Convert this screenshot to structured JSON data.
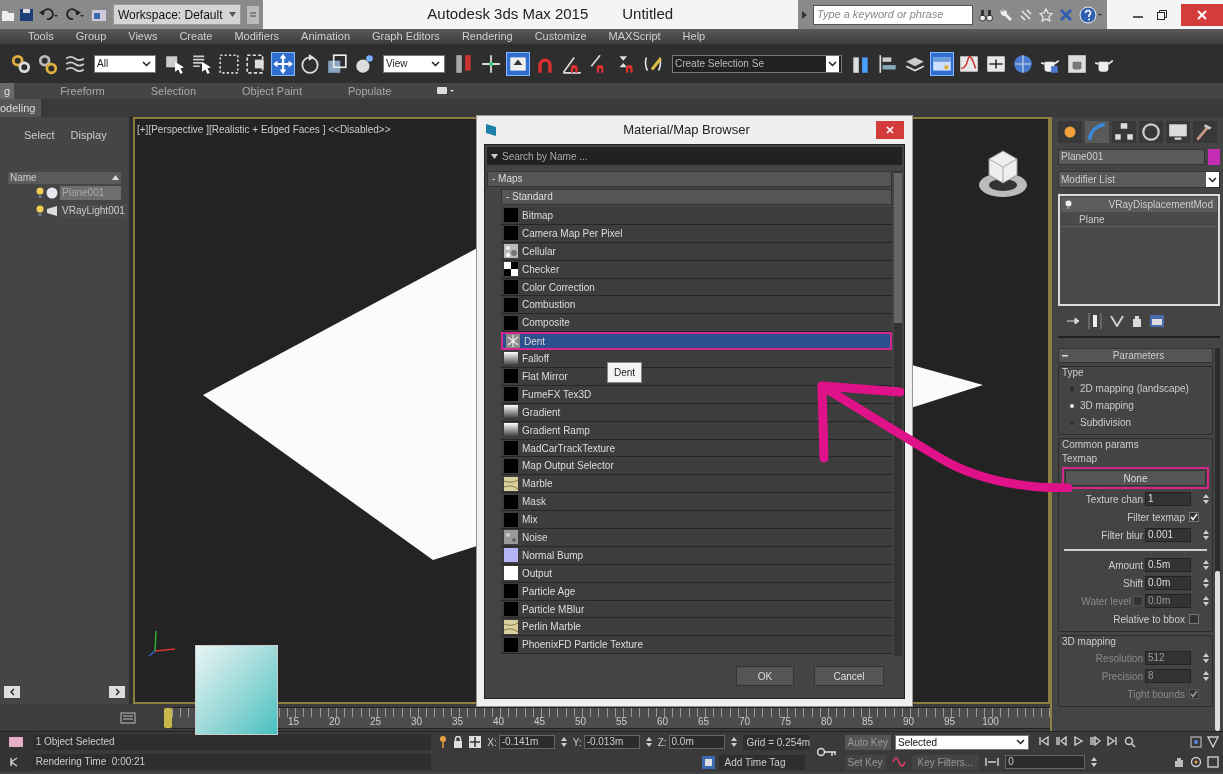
{
  "title_bar": {
    "workspace": "Workspace: Default",
    "app_title": "Autodesk 3ds Max 2015",
    "document": "Untitled",
    "search_placeholder": "Type a keyword or phrase"
  },
  "menu_bar": [
    "Tools",
    "Group",
    "Views",
    "Create",
    "Modifiers",
    "Animation",
    "Graph Editors",
    "Rendering",
    "Customize",
    "MAXScript",
    "Help"
  ],
  "toolbar": [
    {
      "kind": "icon",
      "active": false
    },
    {
      "kind": "icon",
      "active": false
    },
    {
      "kind": "icon",
      "active": false
    },
    {
      "kind": "dropdown",
      "value": "All"
    },
    {
      "kind": "icon",
      "active": false
    },
    {
      "kind": "icon",
      "active": false
    },
    {
      "kind": "icon",
      "active": false
    },
    {
      "kind": "icon",
      "active": false
    },
    {
      "kind": "icon",
      "active": true
    },
    {
      "kind": "icon",
      "active": false
    },
    {
      "kind": "icon",
      "active": false
    },
    {
      "kind": "icon",
      "active": false
    },
    {
      "kind": "dropdown",
      "value": "View"
    },
    {
      "kind": "icon",
      "active": false
    },
    {
      "kind": "icon",
      "active": false
    },
    {
      "kind": "icon",
      "active": true
    },
    {
      "kind": "icon",
      "active": false
    },
    {
      "kind": "icon",
      "active": false
    },
    {
      "kind": "icon",
      "active": false
    },
    {
      "kind": "icon",
      "active": false
    },
    {
      "kind": "icon",
      "active": false
    },
    {
      "kind": "dropdown",
      "value": "Create Selection Se"
    },
    {
      "kind": "icon",
      "active": false
    },
    {
      "kind": "icon",
      "active": false
    },
    {
      "kind": "icon",
      "active": false
    },
    {
      "kind": "icon",
      "active": true
    },
    {
      "kind": "icon",
      "active": false
    },
    {
      "kind": "icon",
      "active": false
    },
    {
      "kind": "icon",
      "active": false
    },
    {
      "kind": "icon",
      "active": false
    },
    {
      "kind": "icon",
      "active": false
    },
    {
      "kind": "icon",
      "active": false
    }
  ],
  "ribbon_tabs": [
    {
      "label": "g",
      "selected": true
    },
    {
      "label": "Freeform",
      "selected": false
    },
    {
      "label": "Selection",
      "selected": false
    },
    {
      "label": "Object Paint",
      "selected": false
    },
    {
      "label": "Populate",
      "selected": false
    }
  ],
  "ribbon_panel": "odeling",
  "scene_explorer": {
    "tabs": [
      "Select",
      "Display"
    ],
    "column": "Name",
    "items": [
      {
        "name": "Plane001",
        "kind": "geometry",
        "selected": true
      },
      {
        "name": "VRayLight001",
        "kind": "light",
        "selected": false
      }
    ]
  },
  "viewport": {
    "label": "[+][Perspective ][Realistic + Edged Faces ] <<Disabled>>"
  },
  "browser": {
    "title": "Material/Map Browser",
    "search_placeholder": "Search by Name ...",
    "group": "- Maps",
    "subgroup": "- Standard",
    "tooltip": "Dent",
    "buttons": [
      "OK",
      "Cancel"
    ],
    "items": [
      {
        "name": "Bitmap",
        "kind": "black",
        "selected": false
      },
      {
        "name": "Camera Map Per Pixel",
        "kind": "black",
        "selected": false
      },
      {
        "name": "Cellular",
        "kind": "cellular",
        "selected": false
      },
      {
        "name": "Checker",
        "kind": "checker",
        "selected": false
      },
      {
        "name": "Color Correction",
        "kind": "black",
        "selected": false
      },
      {
        "name": "Combustion",
        "kind": "black",
        "selected": false
      },
      {
        "name": "Composite",
        "kind": "black",
        "selected": false
      },
      {
        "name": "Dent",
        "kind": "dent",
        "selected": true
      },
      {
        "name": "Falloff",
        "kind": "gradient",
        "selected": false
      },
      {
        "name": "Flat Mirror",
        "kind": "black",
        "selected": false
      },
      {
        "name": "FumeFX Tex3D",
        "kind": "black",
        "selected": false
      },
      {
        "name": "Gradient",
        "kind": "gradient",
        "selected": false
      },
      {
        "name": "Gradient Ramp",
        "kind": "gradient",
        "selected": false
      },
      {
        "name": "MadCarTrackTexture",
        "kind": "black",
        "selected": false
      },
      {
        "name": "Map Output Selector",
        "kind": "black",
        "selected": false
      },
      {
        "name": "Marble",
        "kind": "marble",
        "selected": false
      },
      {
        "name": "Mask",
        "kind": "black",
        "selected": false
      },
      {
        "name": "Mix",
        "kind": "black",
        "selected": false
      },
      {
        "name": "Noise",
        "kind": "noise",
        "selected": false
      },
      {
        "name": "Normal Bump",
        "kind": "normal",
        "selected": false
      },
      {
        "name": "Output",
        "kind": "white",
        "selected": false
      },
      {
        "name": "Particle Age",
        "kind": "black",
        "selected": false
      },
      {
        "name": "Particle MBlur",
        "kind": "black",
        "selected": false
      },
      {
        "name": "Perlin Marble",
        "kind": "marble",
        "selected": false
      },
      {
        "name": "PhoenixFD Particle Texture",
        "kind": "black",
        "selected": false
      }
    ]
  },
  "command_panel": {
    "object": {
      "name": "Plane001",
      "color": "#c42cb4"
    },
    "modifier_list": "Modifier List",
    "stack": [
      {
        "name": "VRayDisplacementMod",
        "selected": true
      },
      {
        "name": "Plane",
        "selected": false
      }
    ],
    "parameters": {
      "title": "Parameters",
      "type_group": "Type",
      "type_options": [
        {
          "label": "2D mapping (landscape)",
          "selected": false
        },
        {
          "label": "3D mapping",
          "selected": true
        },
        {
          "label": "Subdivision",
          "selected": false
        }
      ],
      "common_group": "Common params",
      "texmap_label": "Texmap",
      "texmap_button": "None",
      "texmap_fields": [
        {
          "kind": "spinner",
          "label": "Texture chan",
          "value": "1",
          "disabled": false
        },
        {
          "kind": "checkbox",
          "label": "Filter texmap",
          "checked": true,
          "disabled": false
        },
        {
          "kind": "spinner",
          "label": "Filter blur",
          "value": "0.001",
          "disabled": false
        }
      ],
      "displacement_fields": [
        {
          "kind": "spinner",
          "label": "Amount",
          "value": "0.5m",
          "disabled": false
        },
        {
          "kind": "spinner",
          "label": "Shift",
          "value": "0.0m",
          "disabled": false
        },
        {
          "kind": "check_spinner",
          "label": "Water level",
          "checked": false,
          "value": "0.0m",
          "disabled": true
        },
        {
          "kind": "checkbox",
          "label": "Relative to bbox",
          "checked": false,
          "disabled": false
        }
      ],
      "mapping_group": "3D mapping",
      "mapping_fields": [
        {
          "kind": "spinner",
          "label": "Resolution",
          "value": "512",
          "disabled": true
        },
        {
          "kind": "spinner",
          "label": "Precision",
          "value": "8",
          "disabled": true
        },
        {
          "kind": "checkbox",
          "label": "Tight bounds",
          "checked": true,
          "disabled": true
        }
      ]
    }
  },
  "timeline": {
    "ticks": [
      "15",
      "20",
      "25",
      "30",
      "35",
      "40",
      "45",
      "50",
      "55",
      "60",
      "65",
      "70",
      "75",
      "80",
      "85",
      "90",
      "95",
      "100"
    ]
  },
  "status_bar": {
    "selection": "1 Object Selected",
    "render_time": "Rendering Time  0:00:21",
    "coords": [
      {
        "axis": "X:",
        "value": "-0.141m"
      },
      {
        "axis": "Y:",
        "value": "-0.013m"
      },
      {
        "axis": "Z:",
        "value": "0.0m"
      }
    ],
    "grid": "Grid = 0.254m",
    "add_time_tag": "Add Time Tag",
    "auto_key": "Auto Key",
    "key_mode": "Selected",
    "set_key": "Set Key",
    "key_filters": "Key Filters...",
    "frame": "0"
  }
}
